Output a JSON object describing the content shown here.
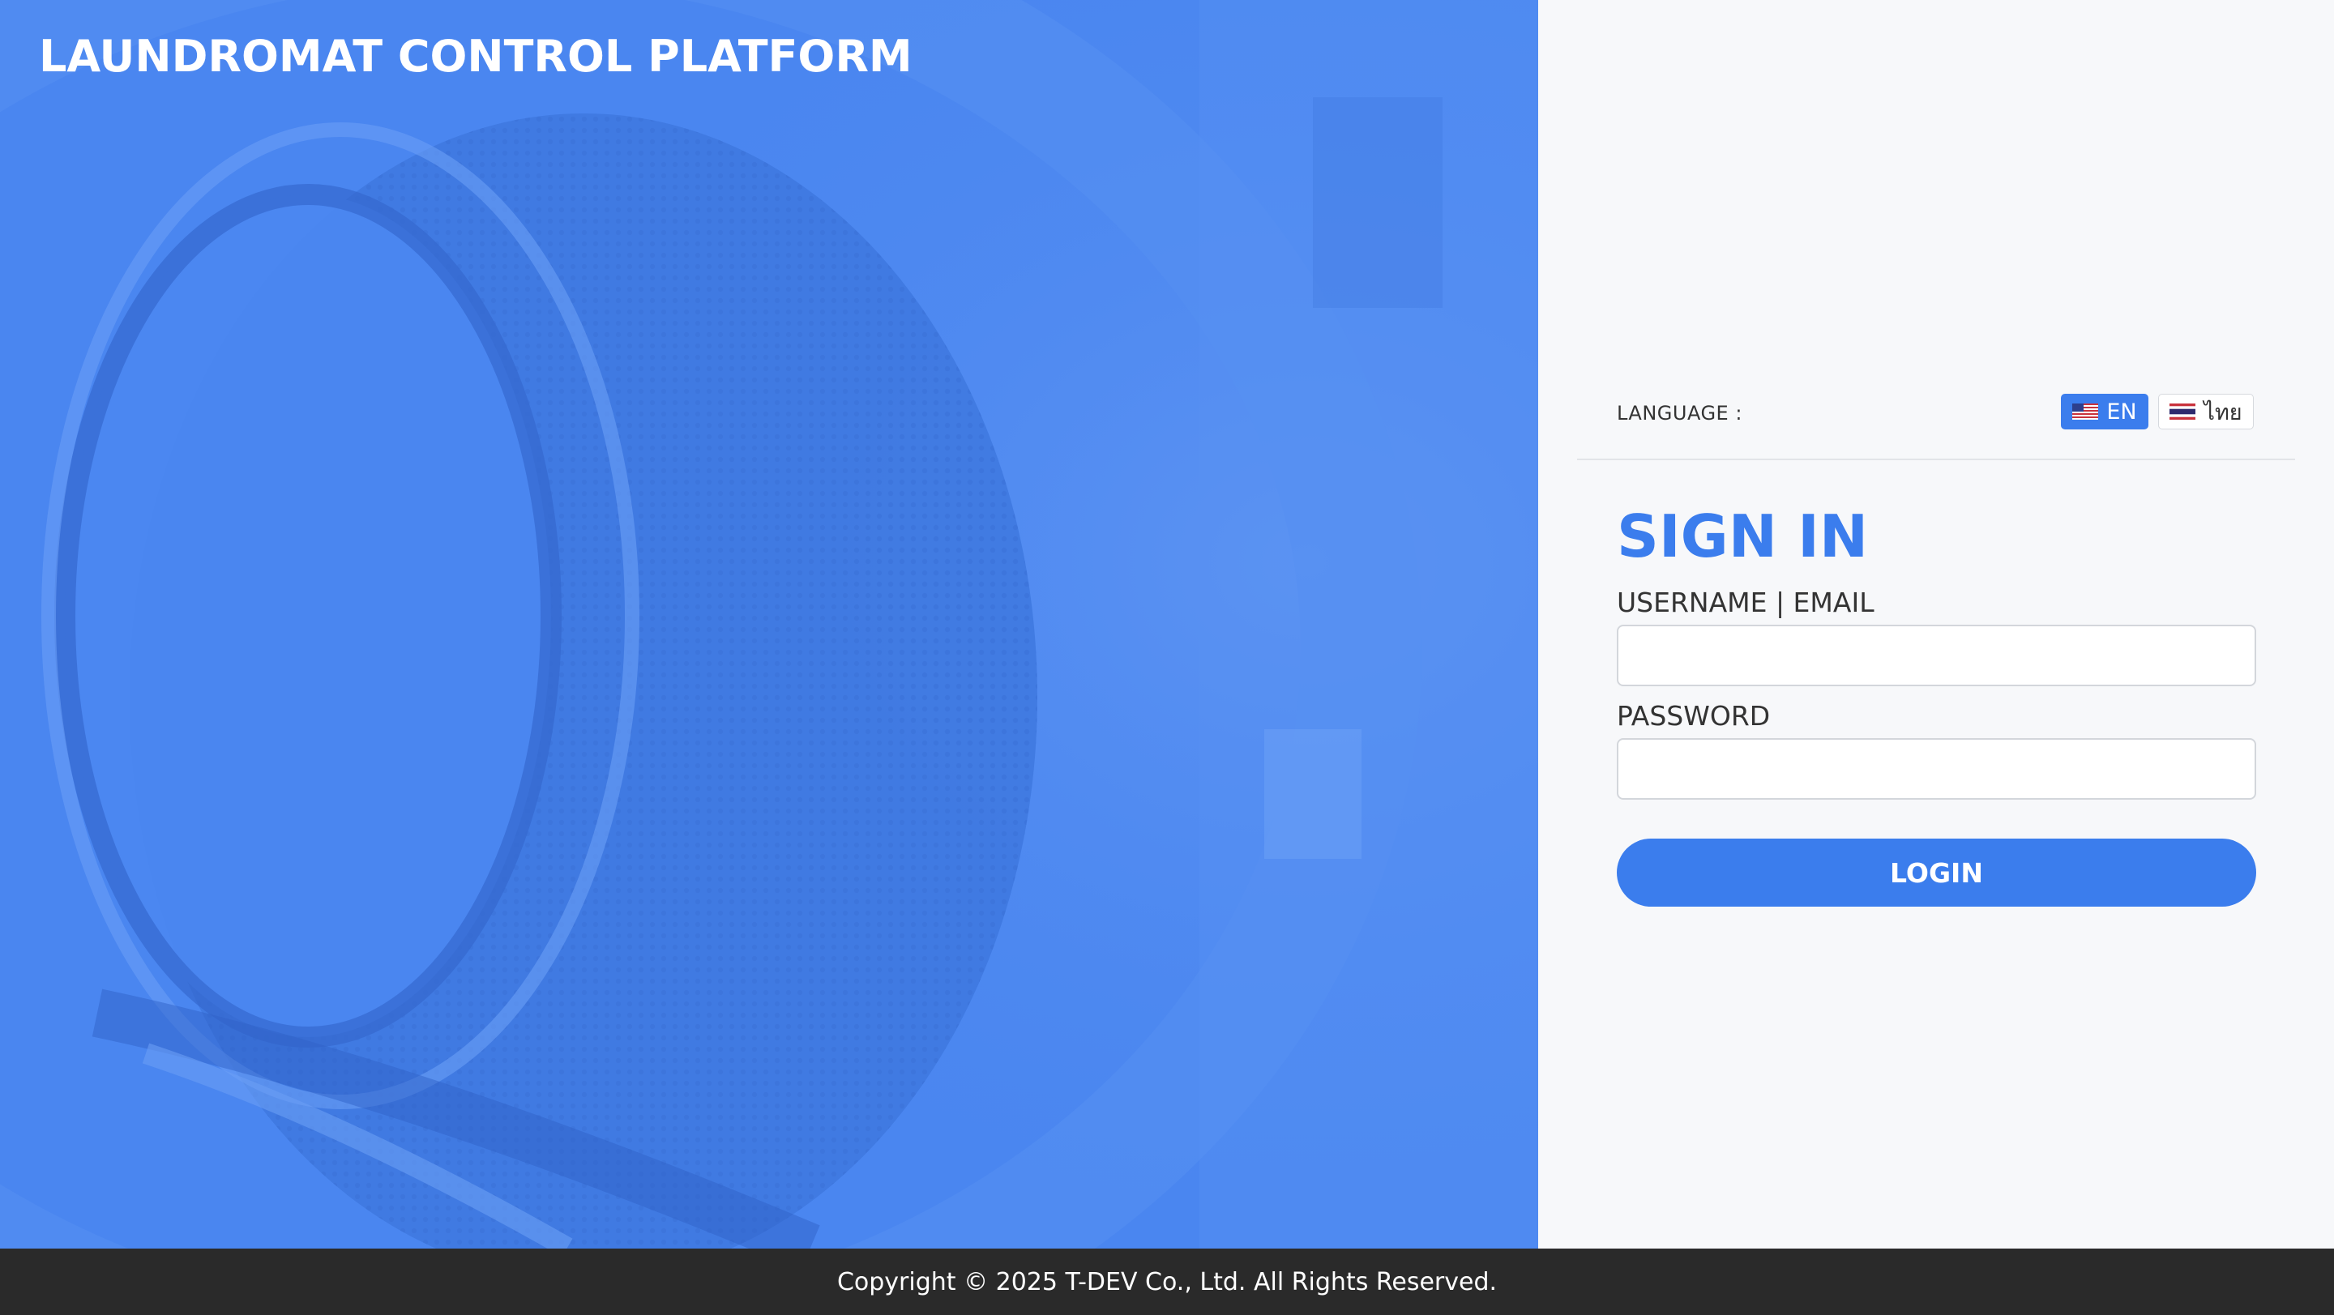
{
  "brand": {
    "title": "LAUNDROMAT CONTROL PLATFORM"
  },
  "language": {
    "label": "LANGUAGE :",
    "options": [
      {
        "label": "EN",
        "flag": "us-flag-icon",
        "selected": true
      },
      {
        "label": "ไทย",
        "flag": "thai-flag-icon",
        "selected": false
      }
    ]
  },
  "signin": {
    "title": "SIGN IN",
    "username_label": "USERNAME | EMAIL",
    "username_value": "",
    "password_label": "PASSWORD",
    "password_value": "",
    "login_label": "LOGIN"
  },
  "footer": {
    "copyright": "Copyright © 2025 T-DEV Co., Ltd. All Rights Reserved."
  },
  "colors": {
    "accent": "#3b7ded",
    "hero_bg": "#4a86f0",
    "footer_bg": "#2a2a2a",
    "panel_bg": "#f7f8fa"
  }
}
